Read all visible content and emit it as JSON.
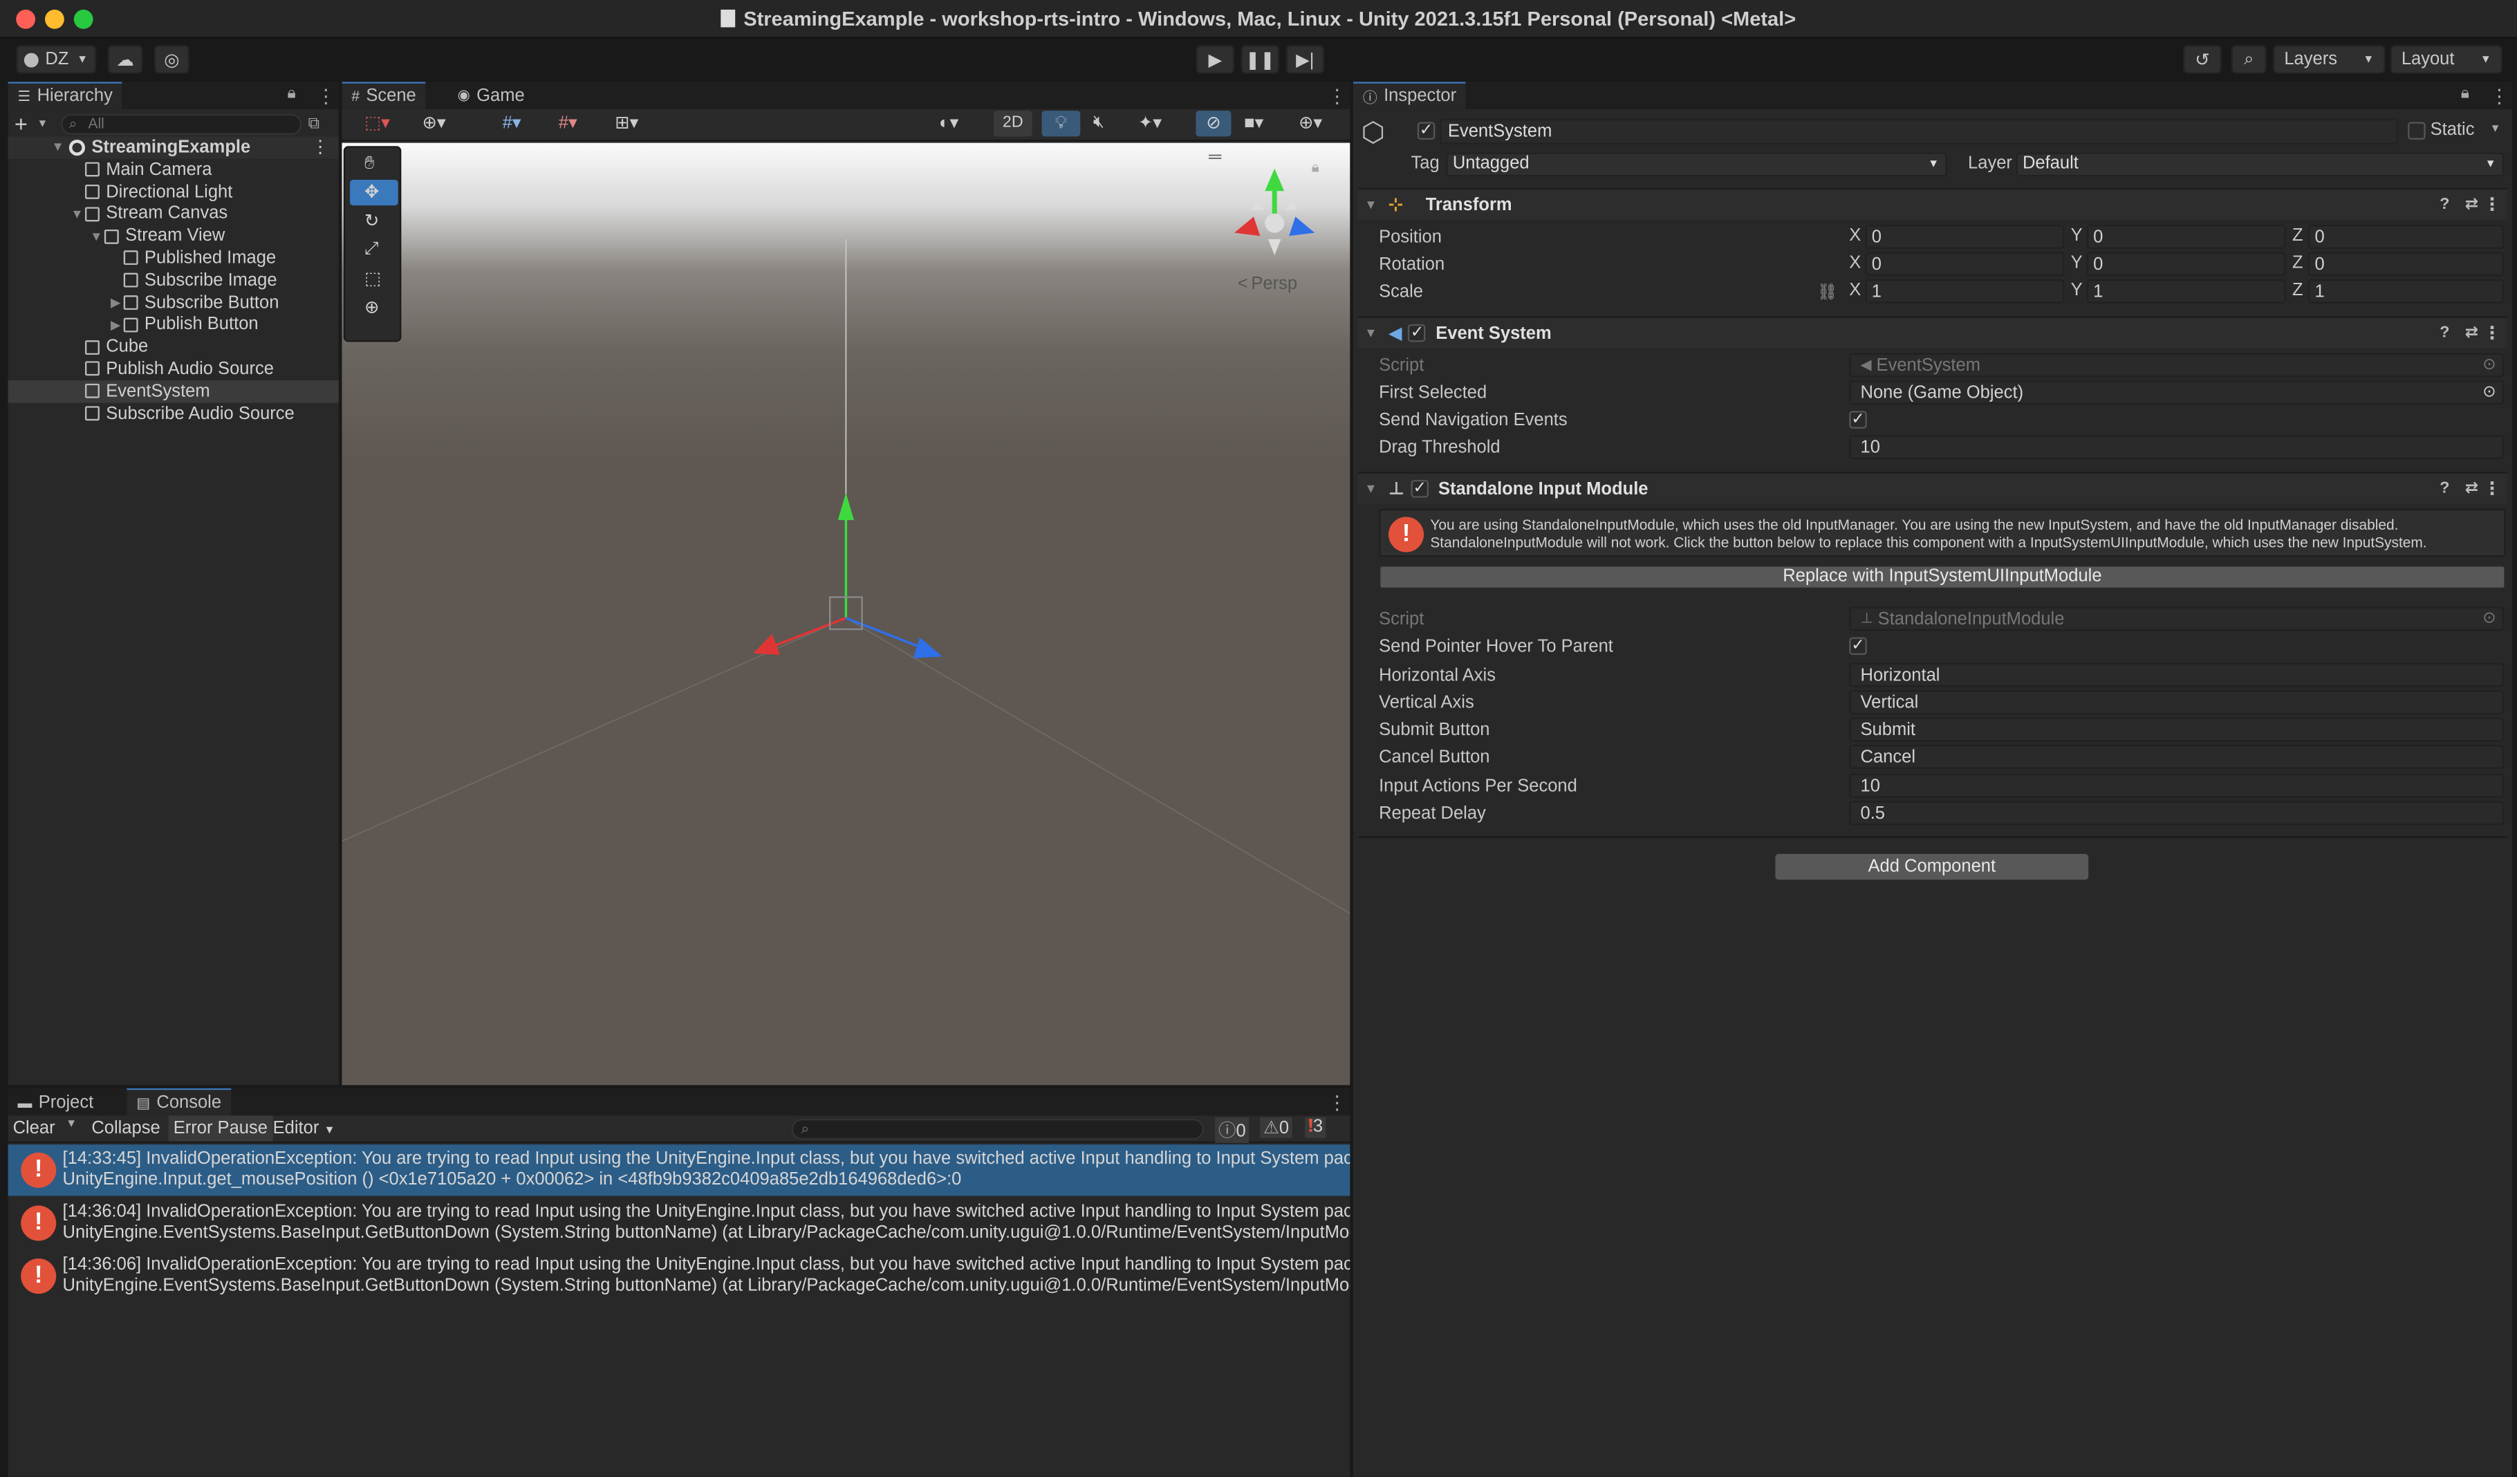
{
  "window": {
    "title": "StreamingExample - workshop-rts-intro - Windows, Mac, Linux - Unity 2021.3.15f1 Personal (Personal) <Metal>"
  },
  "toolbar": {
    "account": "DZ",
    "layers": "Layers",
    "layout": "Layout"
  },
  "hierarchy": {
    "tab": "Hierarchy",
    "search_placeholder": "All",
    "scene": "StreamingExample",
    "items": [
      {
        "label": "Main Camera",
        "depth": 1
      },
      {
        "label": "Directional Light",
        "depth": 1
      },
      {
        "label": "Stream Canvas",
        "depth": 1
      },
      {
        "label": "Stream View",
        "depth": 2
      },
      {
        "label": "Published Image",
        "depth": 3
      },
      {
        "label": "Subscribe Image",
        "depth": 3
      },
      {
        "label": "Subscribe Button",
        "depth": 3
      },
      {
        "label": "Publish Button",
        "depth": 3
      },
      {
        "label": "Cube",
        "depth": 1
      },
      {
        "label": "Publish Audio Source",
        "depth": 1
      },
      {
        "label": "EventSystem",
        "depth": 1
      },
      {
        "label": "Subscribe Audio Source",
        "depth": 1
      }
    ]
  },
  "scene_view": {
    "tabs": [
      "Scene",
      "Game"
    ],
    "toggle_2d": "2D",
    "persp": "Persp"
  },
  "bottom": {
    "tabs": [
      "Project",
      "Console"
    ],
    "clear": "Clear",
    "collapse": "Collapse",
    "error_pause": "Error Pause",
    "editor": "Editor",
    "count_info": "0",
    "count_warn": "0",
    "count_err": "3",
    "logs": [
      {
        "line1": "[14:33:45] InvalidOperationException: You are trying to read Input using the UnityEngine.Input class, but you have switched active Input handling to Input System packa",
        "line2": "UnityEngine.Input.get_mousePosition () <0x1e7105a20 + 0x00062> in <48fb9b9382c0409a85e2db164968ded6>:0"
      },
      {
        "line1": "[14:36:04] InvalidOperationException: You are trying to read Input using the UnityEngine.Input class, but you have switched active Input handling to Input System packa",
        "line2": "UnityEngine.EventSystems.BaseInput.GetButtonDown (System.String buttonName) (at Library/PackageCache/com.unity.ugui@1.0.0/Runtime/EventSystem/InputModu"
      },
      {
        "line1": "[14:36:06] InvalidOperationException: You are trying to read Input using the UnityEngine.Input class, but you have switched active Input handling to Input System packa",
        "line2": "UnityEngine.EventSystems.BaseInput.GetButtonDown (System.String buttonName) (at Library/PackageCache/com.unity.ugui@1.0.0/Runtime/EventSystem/InputModu"
      }
    ]
  },
  "inspector": {
    "tab": "Inspector",
    "object_name": "EventSystem",
    "static_label": "Static",
    "tag_label": "Tag",
    "tag_value": "Untagged",
    "layer_label": "Layer",
    "layer_value": "Default",
    "transform": {
      "title": "Transform",
      "position_label": "Position",
      "rotation_label": "Rotation",
      "scale_label": "Scale",
      "axis_x": "X",
      "axis_y": "Y",
      "axis_z": "Z",
      "position": [
        "0",
        "0",
        "0"
      ],
      "rotation": [
        "0",
        "0",
        "0"
      ],
      "scale": [
        "1",
        "1",
        "1"
      ]
    },
    "event_system": {
      "title": "Event System",
      "script_label": "Script",
      "script_value": "EventSystem",
      "first_selected_label": "First Selected",
      "first_selected_value": "None (Game Object)",
      "send_nav_label": "Send Navigation Events",
      "drag_threshold_label": "Drag Threshold",
      "drag_threshold_value": "10"
    },
    "standalone": {
      "title": "Standalone Input Module",
      "warning_line1": "You are using StandaloneInputModule, which uses the old InputManager. You are using the new InputSystem, and have the old InputManager disabled.",
      "warning_line2": "StandaloneInputModule will not work. Click the button below to replace this component with a InputSystemUIInputModule, which uses the new InputSystem.",
      "replace_button": "Replace with InputSystemUIInputModule",
      "script_label": "Script",
      "script_value": "StandaloneInputModule",
      "hover_label": "Send Pointer Hover To Parent",
      "horizontal_label": "Horizontal Axis",
      "horizontal_value": "Horizontal",
      "vertical_label": "Vertical Axis",
      "vertical_value": "Vertical",
      "submit_label": "Submit Button",
      "submit_value": "Submit",
      "cancel_label": "Cancel Button",
      "cancel_value": "Cancel",
      "ips_label": "Input Actions Per Second",
      "ips_value": "10",
      "repeat_label": "Repeat Delay",
      "repeat_value": "0.5"
    },
    "add_component": "Add Component"
  }
}
